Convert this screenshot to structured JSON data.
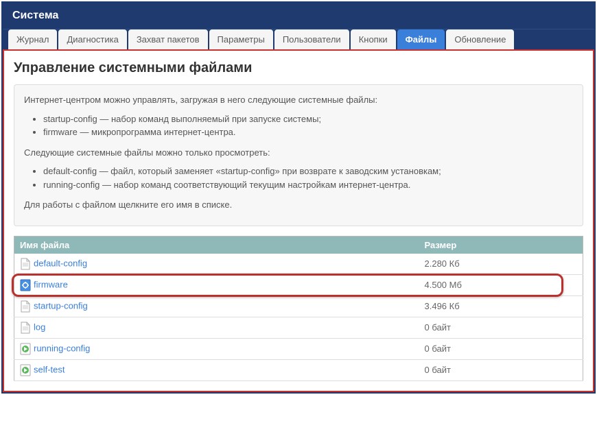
{
  "header": {
    "title": "Система"
  },
  "tabs": [
    {
      "label": "Журнал",
      "active": false
    },
    {
      "label": "Диагностика",
      "active": false
    },
    {
      "label": "Захват пакетов",
      "active": false
    },
    {
      "label": "Параметры",
      "active": false
    },
    {
      "label": "Пользователи",
      "active": false
    },
    {
      "label": "Кнопки",
      "active": false
    },
    {
      "label": "Файлы",
      "active": true
    },
    {
      "label": "Обновление",
      "active": false
    }
  ],
  "page": {
    "title": "Управление системными файлами",
    "intro1": "Интернет-центром можно управлять, загружая в него следующие системные файлы:",
    "bullets1": [
      "startup-config — набор команд выполняемый при запуске системы;",
      "firmware — микропрограмма интернет-центра."
    ],
    "intro2": "Следующие системные файлы можно только просмотреть:",
    "bullets2": [
      "default-config — файл, который заменяет «startup-config» при возврате к заводским установкам;",
      "running-config — набор команд соответствующий текущим настройкам интернет-центра."
    ],
    "intro3": "Для работы с файлом щелкните его имя в списке."
  },
  "table": {
    "col_name": "Имя файла",
    "col_size": "Размер",
    "rows": [
      {
        "icon": "file",
        "name": "default-config",
        "size": "2.280 Кб",
        "hl": false
      },
      {
        "icon": "gear",
        "name": "firmware",
        "size": "4.500 Мб",
        "hl": true
      },
      {
        "icon": "file",
        "name": "startup-config",
        "size": "3.496 Кб",
        "hl": false
      },
      {
        "icon": "file",
        "name": "log",
        "size": "0 байт",
        "hl": false
      },
      {
        "icon": "run",
        "name": "running-config",
        "size": "0 байт",
        "hl": false
      },
      {
        "icon": "run",
        "name": "self-test",
        "size": "0 байт",
        "hl": false
      }
    ]
  }
}
